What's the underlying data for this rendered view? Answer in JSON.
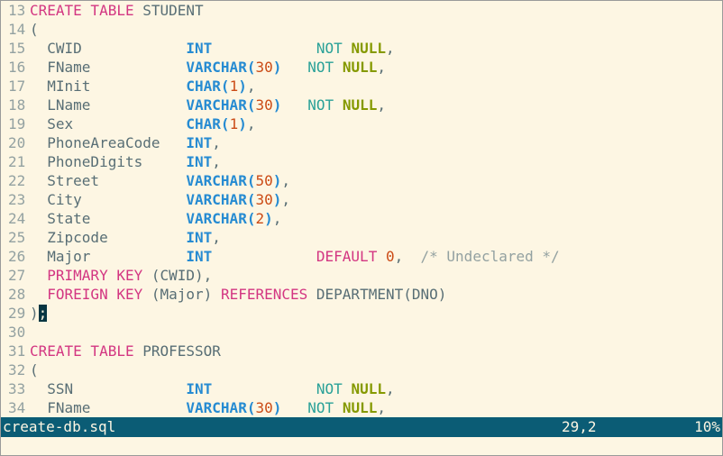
{
  "editor": {
    "lines": [
      {
        "num": "13",
        "tokens": [
          {
            "t": "CREATE TABLE",
            "c": "k-red"
          },
          {
            "t": " STUDENT",
            "c": "plain"
          }
        ]
      },
      {
        "num": "14",
        "tokens": [
          {
            "t": "(",
            "c": "plain"
          }
        ]
      },
      {
        "num": "15",
        "tokens": [
          {
            "t": "  CWID            ",
            "c": "plain"
          },
          {
            "t": "INT",
            "c": "t-blue"
          },
          {
            "t": "            ",
            "c": "plain"
          },
          {
            "t": "NOT",
            "c": "not-cyan"
          },
          {
            "t": " ",
            "c": "plain"
          },
          {
            "t": "NULL",
            "c": "null-green"
          },
          {
            "t": ",",
            "c": "plain"
          }
        ]
      },
      {
        "num": "16",
        "tokens": [
          {
            "t": "  FName           ",
            "c": "plain"
          },
          {
            "t": "VARCHAR",
            "c": "t-blue"
          },
          {
            "t": "(",
            "c": "t-blue"
          },
          {
            "t": "30",
            "c": "n-orange"
          },
          {
            "t": ")",
            "c": "t-blue"
          },
          {
            "t": "   ",
            "c": "plain"
          },
          {
            "t": "NOT",
            "c": "not-cyan"
          },
          {
            "t": " ",
            "c": "plain"
          },
          {
            "t": "NULL",
            "c": "null-green"
          },
          {
            "t": ",",
            "c": "plain"
          }
        ]
      },
      {
        "num": "17",
        "tokens": [
          {
            "t": "  MInit           ",
            "c": "plain"
          },
          {
            "t": "CHAR",
            "c": "t-blue"
          },
          {
            "t": "(",
            "c": "t-blue"
          },
          {
            "t": "1",
            "c": "n-orange"
          },
          {
            "t": ")",
            "c": "t-blue"
          },
          {
            "t": ",",
            "c": "plain"
          }
        ]
      },
      {
        "num": "18",
        "tokens": [
          {
            "t": "  LName           ",
            "c": "plain"
          },
          {
            "t": "VARCHAR",
            "c": "t-blue"
          },
          {
            "t": "(",
            "c": "t-blue"
          },
          {
            "t": "30",
            "c": "n-orange"
          },
          {
            "t": ")",
            "c": "t-blue"
          },
          {
            "t": "   ",
            "c": "plain"
          },
          {
            "t": "NOT",
            "c": "not-cyan"
          },
          {
            "t": " ",
            "c": "plain"
          },
          {
            "t": "NULL",
            "c": "null-green"
          },
          {
            "t": ",",
            "c": "plain"
          }
        ]
      },
      {
        "num": "19",
        "tokens": [
          {
            "t": "  Sex             ",
            "c": "plain"
          },
          {
            "t": "CHAR",
            "c": "t-blue"
          },
          {
            "t": "(",
            "c": "t-blue"
          },
          {
            "t": "1",
            "c": "n-orange"
          },
          {
            "t": ")",
            "c": "t-blue"
          },
          {
            "t": ",",
            "c": "plain"
          }
        ]
      },
      {
        "num": "20",
        "tokens": [
          {
            "t": "  PhoneAreaCode   ",
            "c": "plain"
          },
          {
            "t": "INT",
            "c": "t-blue"
          },
          {
            "t": ",",
            "c": "plain"
          }
        ]
      },
      {
        "num": "21",
        "tokens": [
          {
            "t": "  PhoneDigits     ",
            "c": "plain"
          },
          {
            "t": "INT",
            "c": "t-blue"
          },
          {
            "t": ",",
            "c": "plain"
          }
        ]
      },
      {
        "num": "22",
        "tokens": [
          {
            "t": "  Street          ",
            "c": "plain"
          },
          {
            "t": "VARCHAR",
            "c": "t-blue"
          },
          {
            "t": "(",
            "c": "t-blue"
          },
          {
            "t": "50",
            "c": "n-orange"
          },
          {
            "t": ")",
            "c": "t-blue"
          },
          {
            "t": ",",
            "c": "plain"
          }
        ]
      },
      {
        "num": "23",
        "tokens": [
          {
            "t": "  City            ",
            "c": "plain"
          },
          {
            "t": "VARCHAR",
            "c": "t-blue"
          },
          {
            "t": "(",
            "c": "t-blue"
          },
          {
            "t": "30",
            "c": "n-orange"
          },
          {
            "t": ")",
            "c": "t-blue"
          },
          {
            "t": ",",
            "c": "plain"
          }
        ]
      },
      {
        "num": "24",
        "tokens": [
          {
            "t": "  State           ",
            "c": "plain"
          },
          {
            "t": "VARCHAR",
            "c": "t-blue"
          },
          {
            "t": "(",
            "c": "t-blue"
          },
          {
            "t": "2",
            "c": "n-orange"
          },
          {
            "t": ")",
            "c": "t-blue"
          },
          {
            "t": ",",
            "c": "plain"
          }
        ]
      },
      {
        "num": "25",
        "tokens": [
          {
            "t": "  Zipcode         ",
            "c": "plain"
          },
          {
            "t": "INT",
            "c": "t-blue"
          },
          {
            "t": ",",
            "c": "plain"
          }
        ]
      },
      {
        "num": "26",
        "tokens": [
          {
            "t": "  Major           ",
            "c": "plain"
          },
          {
            "t": "INT",
            "c": "t-blue"
          },
          {
            "t": "            ",
            "c": "plain"
          },
          {
            "t": "DEFAULT",
            "c": "k-red"
          },
          {
            "t": " ",
            "c": "plain"
          },
          {
            "t": "0",
            "c": "n-orange"
          },
          {
            "t": ",  ",
            "c": "plain"
          },
          {
            "t": "/* Undeclared */",
            "c": "comment"
          }
        ]
      },
      {
        "num": "27",
        "tokens": [
          {
            "t": "  ",
            "c": "plain"
          },
          {
            "t": "PRIMARY KEY",
            "c": "k-red"
          },
          {
            "t": " (CWID),",
            "c": "plain"
          }
        ]
      },
      {
        "num": "28",
        "tokens": [
          {
            "t": "  ",
            "c": "plain"
          },
          {
            "t": "FOREIGN KEY",
            "c": "k-red"
          },
          {
            "t": " (Major) ",
            "c": "plain"
          },
          {
            "t": "REFERENCES",
            "c": "k-red"
          },
          {
            "t": " DEPARTMENT(DNO)",
            "c": "plain"
          }
        ]
      },
      {
        "num": "29",
        "tokens": [
          {
            "t": ")",
            "c": "plain"
          },
          {
            "t": ";",
            "c": "cursor"
          }
        ]
      },
      {
        "num": "30",
        "tokens": []
      },
      {
        "num": "31",
        "tokens": [
          {
            "t": "CREATE TABLE",
            "c": "k-red"
          },
          {
            "t": " PROFESSOR",
            "c": "plain"
          }
        ]
      },
      {
        "num": "32",
        "tokens": [
          {
            "t": "(",
            "c": "plain"
          }
        ]
      },
      {
        "num": "33",
        "tokens": [
          {
            "t": "  SSN             ",
            "c": "plain"
          },
          {
            "t": "INT",
            "c": "t-blue"
          },
          {
            "t": "            ",
            "c": "plain"
          },
          {
            "t": "NOT",
            "c": "not-cyan"
          },
          {
            "t": " ",
            "c": "plain"
          },
          {
            "t": "NULL",
            "c": "null-green"
          },
          {
            "t": ",",
            "c": "plain"
          }
        ]
      },
      {
        "num": "34",
        "tokens": [
          {
            "t": "  FName           ",
            "c": "plain"
          },
          {
            "t": "VARCHAR",
            "c": "t-blue"
          },
          {
            "t": "(",
            "c": "t-blue"
          },
          {
            "t": "30",
            "c": "n-orange"
          },
          {
            "t": ")",
            "c": "t-blue"
          },
          {
            "t": "   ",
            "c": "plain"
          },
          {
            "t": "NOT",
            "c": "not-cyan"
          },
          {
            "t": " ",
            "c": "plain"
          },
          {
            "t": "NULL",
            "c": "null-green"
          },
          {
            "t": ",",
            "c": "plain"
          }
        ]
      }
    ]
  },
  "statusbar": {
    "filename": "create-db.sql",
    "position": "29,2",
    "percent": "10%"
  },
  "colors": {
    "background": "#fdf6e3",
    "keyword": "#d33682",
    "type": "#268bd2",
    "number": "#cb4b16",
    "not": "#2aa198",
    "null": "#859900",
    "comment": "#93a1a1",
    "statusbar": "#0b5c75"
  }
}
